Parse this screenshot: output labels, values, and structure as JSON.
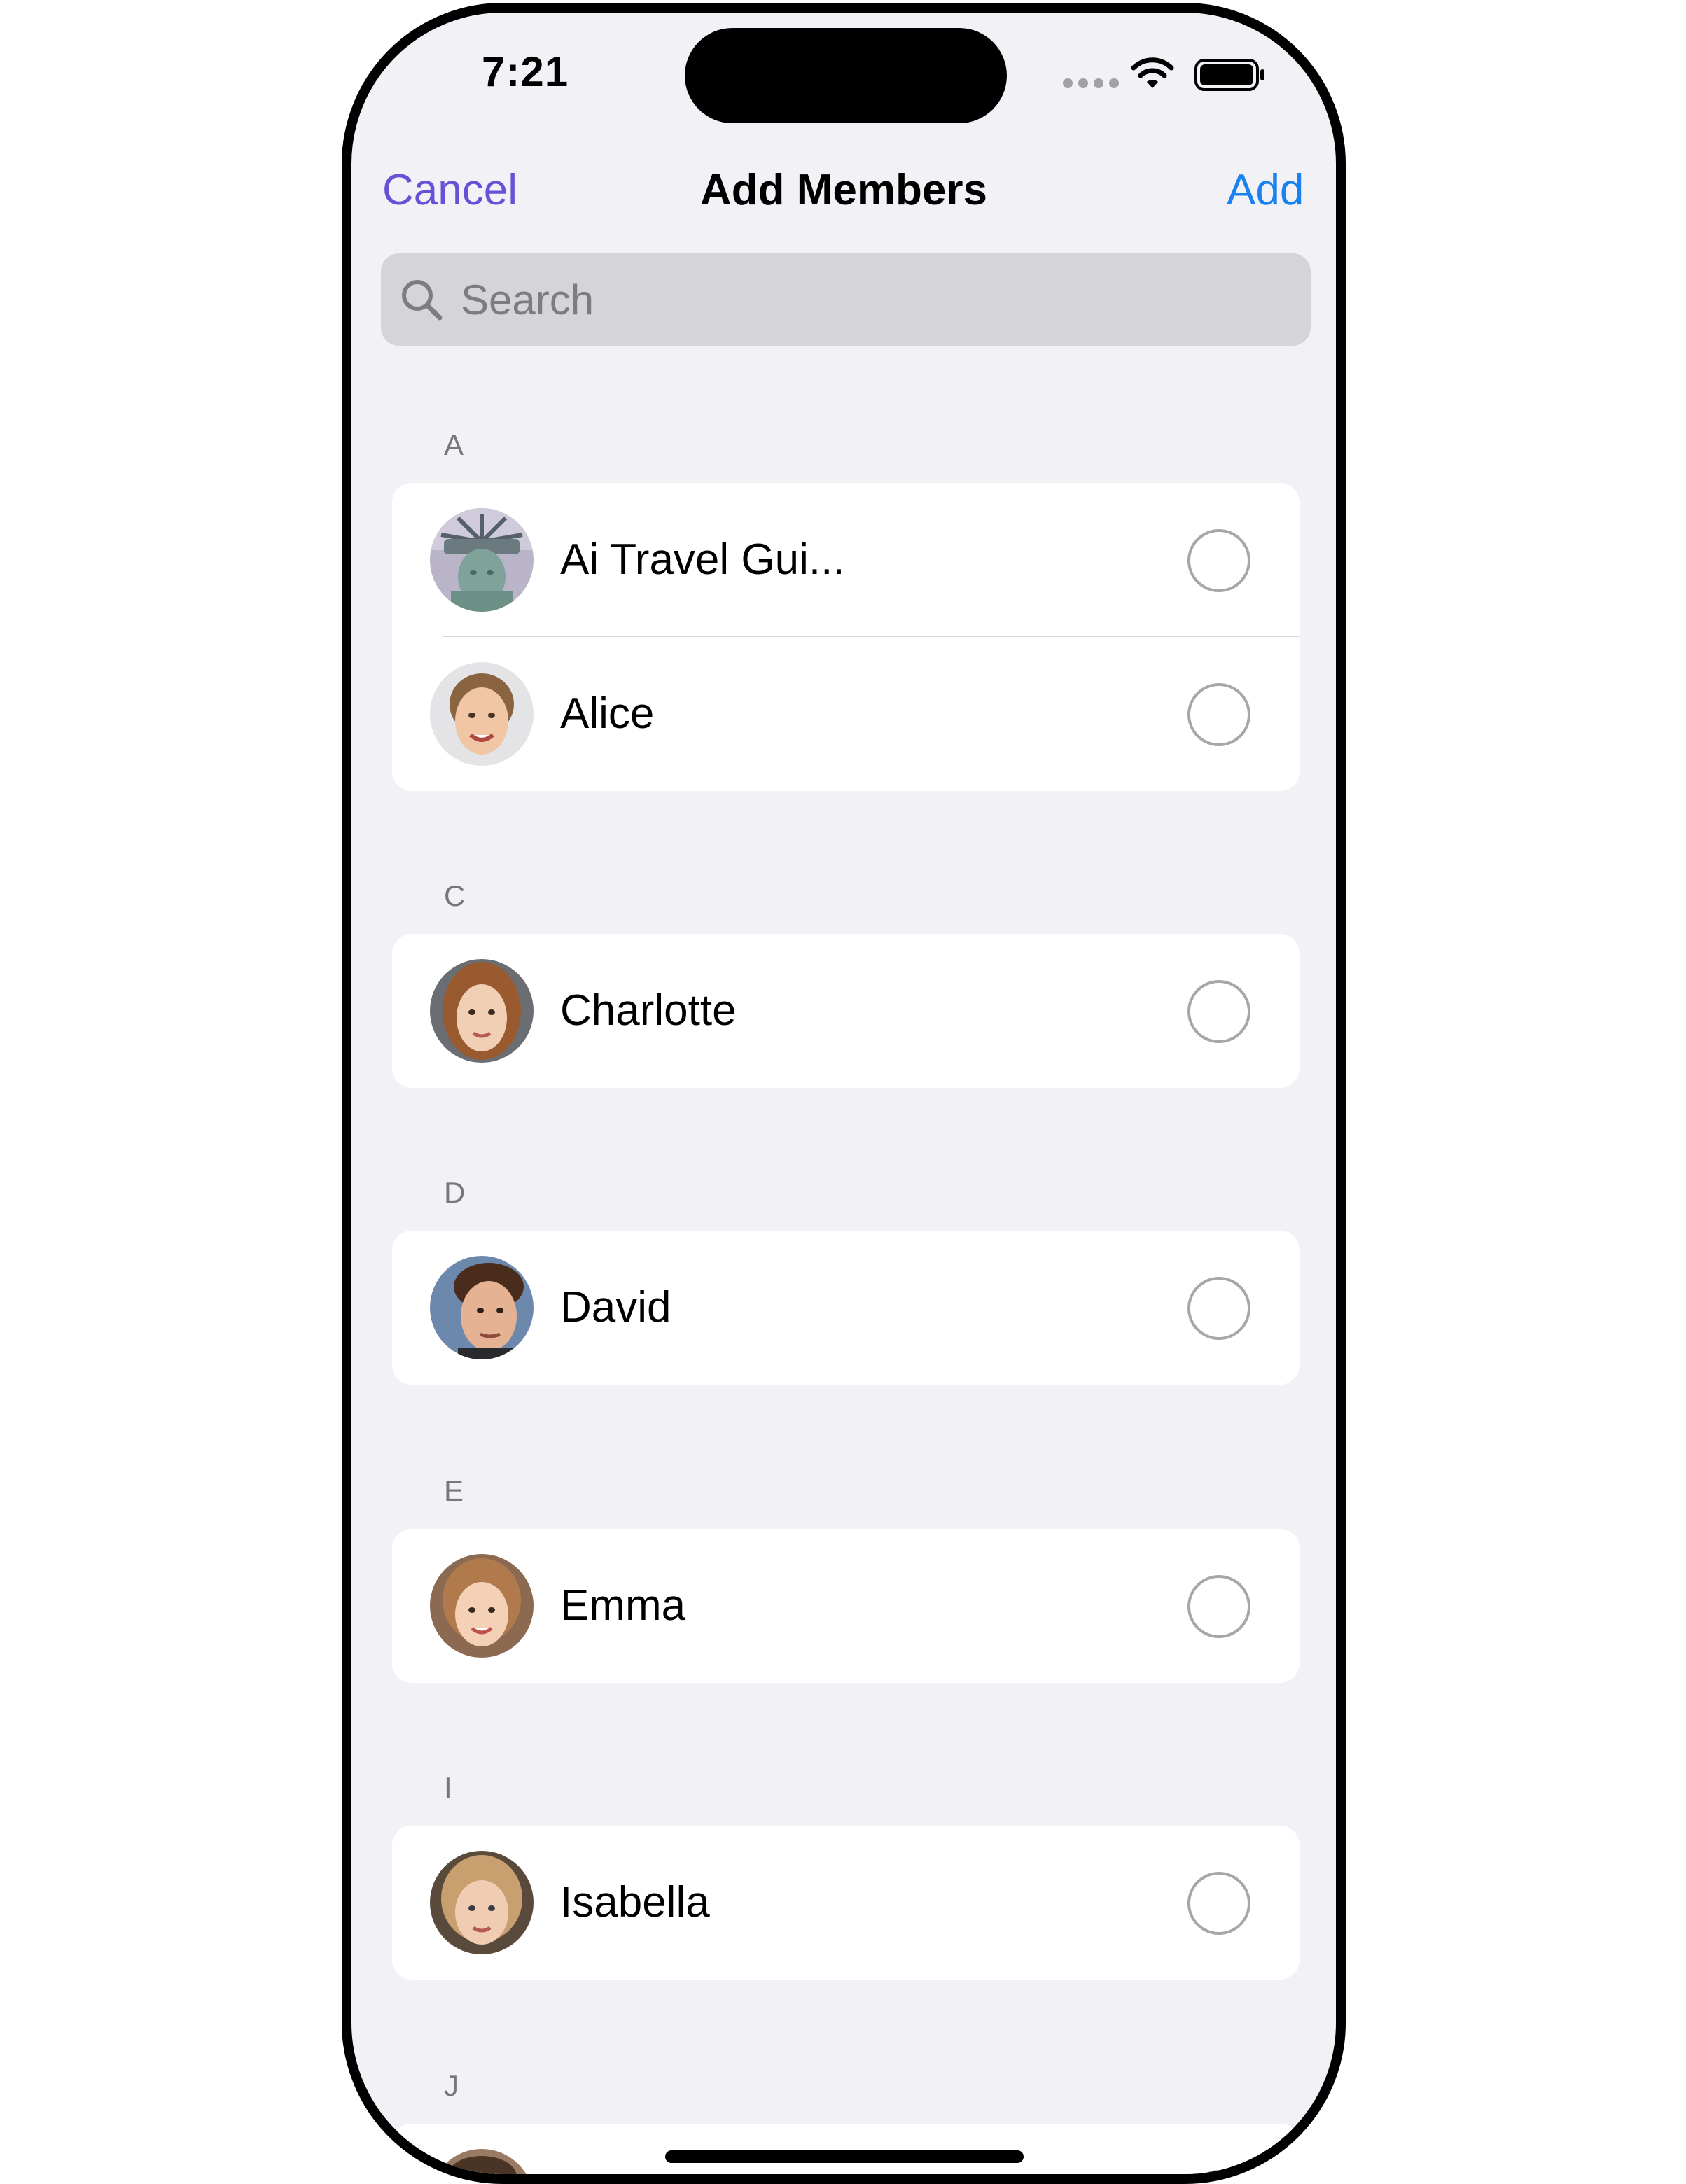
{
  "status_bar": {
    "time": "7:21",
    "icons": [
      "signal-dots-icon",
      "wifi-icon",
      "battery-icon"
    ]
  },
  "nav": {
    "cancel_label": "Cancel",
    "title": "Add Members",
    "add_label": "Add",
    "colors": {
      "cancel": "#6851d6",
      "add": "#1a82f0"
    }
  },
  "search": {
    "placeholder": "Search",
    "value": ""
  },
  "sections": [
    {
      "letter": "A",
      "members": [
        {
          "name": "Ai Travel Gui...",
          "avatar": "statue-of-liberty-avatar",
          "selected": false
        },
        {
          "name": "Alice",
          "avatar": "alice-avatar",
          "selected": false
        }
      ]
    },
    {
      "letter": "C",
      "members": [
        {
          "name": "Charlotte",
          "avatar": "charlotte-avatar",
          "selected": false
        }
      ]
    },
    {
      "letter": "D",
      "members": [
        {
          "name": "David",
          "avatar": "david-avatar",
          "selected": false
        }
      ]
    },
    {
      "letter": "E",
      "members": [
        {
          "name": "Emma",
          "avatar": "emma-avatar",
          "selected": false
        }
      ]
    },
    {
      "letter": "I",
      "members": [
        {
          "name": "Isabella",
          "avatar": "isabella-avatar",
          "selected": false
        }
      ]
    },
    {
      "letter": "J",
      "members": []
    }
  ]
}
